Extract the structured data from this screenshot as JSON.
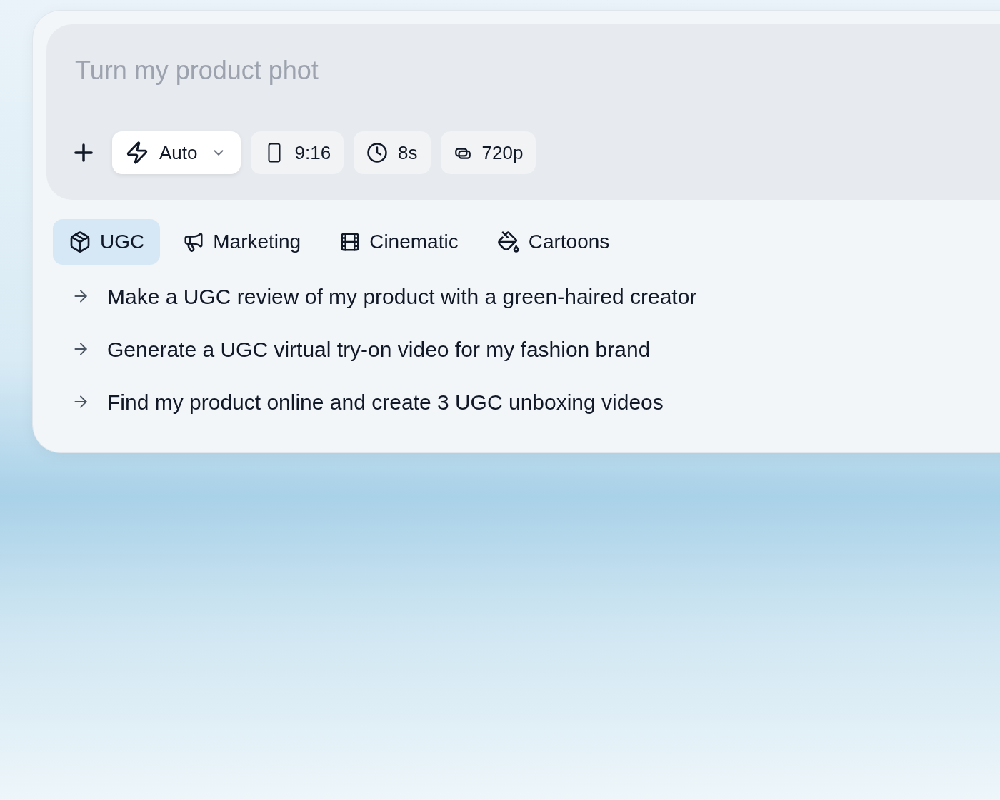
{
  "prompt": {
    "placeholder": "Turn my product phot"
  },
  "options": [
    {
      "kind": "dropdown",
      "label": "Auto"
    },
    {
      "kind": "chip",
      "label": "9:16"
    },
    {
      "kind": "chip",
      "label": "8s"
    },
    {
      "kind": "chip",
      "label": "720p"
    }
  ],
  "categories": [
    {
      "label": "UGC",
      "selected": true
    },
    {
      "label": "Marketing",
      "selected": false
    },
    {
      "label": "Cinematic",
      "selected": false
    },
    {
      "label": "Cartoons",
      "selected": false
    }
  ],
  "suggestions": [
    "Make a UGC review of my product with a green-haired creator",
    "Generate a UGC virtual try-on video for my fashion brand",
    "Find my product online and create 3 UGC unboxing videos"
  ]
}
